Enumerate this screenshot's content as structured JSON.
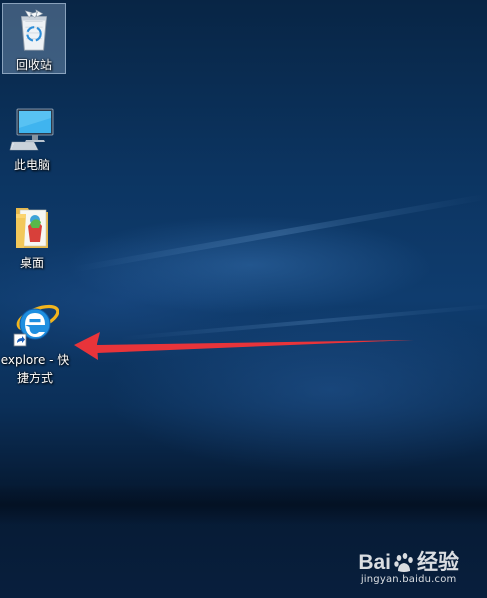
{
  "desktop": {
    "icons": [
      {
        "id": "recycle-bin",
        "label": "回收站",
        "icon": "recycle-bin-icon"
      },
      {
        "id": "this-pc",
        "label": "此电脑",
        "icon": "computer-icon"
      },
      {
        "id": "desktop-folder",
        "label": "桌面",
        "icon": "folder-icon"
      },
      {
        "id": "ie-shortcut",
        "label_line1": "explore - 快",
        "label_line2": "捷方式",
        "icon": "internet-explorer-icon"
      }
    ]
  },
  "annotation": {
    "color": "#e8343a",
    "icon": "red-arrow-icon"
  },
  "watermark": {
    "brand_left": "Bai",
    "brand_right": "经验",
    "url": "jingyan.baidu.com"
  }
}
